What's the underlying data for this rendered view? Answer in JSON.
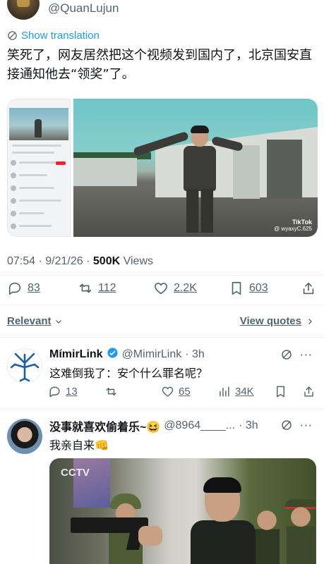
{
  "author": {
    "handle": "@QuanLujun"
  },
  "translate": {
    "label": "Show translation"
  },
  "tweet": {
    "text": "笑死了，网友居然把这个视频发到国内了，北京国安直接通知他去“领奖”了。"
  },
  "media": {
    "watermark_brand": "TikTok",
    "watermark_user": "@ wyaxyC.625"
  },
  "meta": {
    "time": "07:54",
    "date": "9/21/26",
    "views_count": "500K",
    "views_label": "Views",
    "separator": "·"
  },
  "actions": {
    "replies": "83",
    "reposts": "112",
    "likes": "2.2K",
    "bookmarks": "603"
  },
  "sort": {
    "label": "Relevant",
    "view_quotes": "View quotes"
  },
  "replies": [
    {
      "name": "MímirLink",
      "handle": "@MimirLink",
      "time": "· 3h",
      "text": "这难倒我了：安个什么罪名呢？",
      "stats": {
        "replies": "13",
        "likes": "65",
        "views": "34K"
      }
    },
    {
      "name": "没事就喜欢偷着乐~😆",
      "handle": "@8964____...",
      "time": "· 3h",
      "text": "我亲自来👊",
      "photo_watermark": "CCTV"
    }
  ],
  "colors": {
    "accent": "#1d9bf0",
    "text": "#0f1419",
    "muted": "#536471",
    "verified": "#1d9bf0"
  }
}
